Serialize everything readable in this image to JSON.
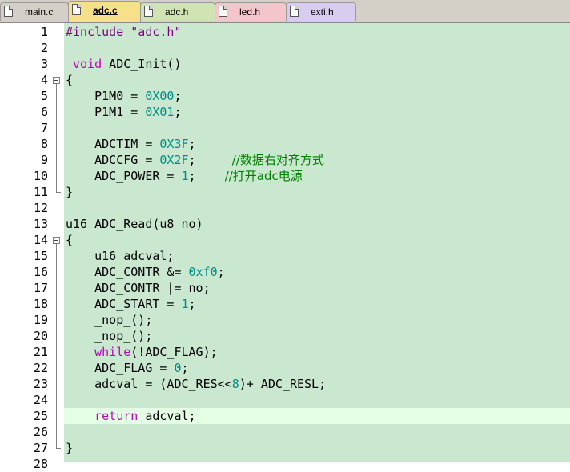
{
  "tabs": [
    {
      "label": "main.c",
      "active": false,
      "color": "#d4d0c8"
    },
    {
      "label": "adc.c",
      "active": true,
      "color": "#f6e18a"
    },
    {
      "label": "adc.h",
      "active": false,
      "color": "#cfe4b2"
    },
    {
      "label": "led.h",
      "active": false,
      "color": "#f4c6cc"
    },
    {
      "label": "exti.h",
      "active": false,
      "color": "#d8cdf0"
    }
  ],
  "editor": {
    "background": "#c9e8cf",
    "current_line_background": "#e5ffe5",
    "current_line": 25,
    "line_numbers": [
      "1",
      "2",
      "3",
      "4",
      "5",
      "6",
      "7",
      "8",
      "9",
      "10",
      "11",
      "12",
      "13",
      "14",
      "15",
      "16",
      "17",
      "18",
      "19",
      "20",
      "21",
      "22",
      "23",
      "24",
      "25",
      "26",
      "27",
      "28"
    ],
    "fold_markers": [
      4,
      14
    ],
    "lines": [
      [
        {
          "t": "#include ",
          "c": "pp"
        },
        {
          "t": "\"adc.h\"",
          "c": "str"
        }
      ],
      [],
      [
        {
          "t": " "
        },
        {
          "t": "void",
          "c": "kw"
        },
        {
          "t": " ADC_Init()"
        }
      ],
      [
        {
          "t": "{"
        }
      ],
      [
        {
          "t": "    P1M0 = "
        },
        {
          "t": "0X00",
          "c": "num"
        },
        {
          "t": ";"
        }
      ],
      [
        {
          "t": "    P1M1 = "
        },
        {
          "t": "0X01",
          "c": "num"
        },
        {
          "t": ";"
        }
      ],
      [],
      [
        {
          "t": "    ADCTIM = "
        },
        {
          "t": "0X3F",
          "c": "num"
        },
        {
          "t": ";"
        }
      ],
      [
        {
          "t": "    ADCCFG = "
        },
        {
          "t": "0X2F",
          "c": "num"
        },
        {
          "t": ";     "
        },
        {
          "t": "//数据右对齐方式",
          "c": "cm"
        }
      ],
      [
        {
          "t": "    ADC_POWER = "
        },
        {
          "t": "1",
          "c": "num"
        },
        {
          "t": ";    "
        },
        {
          "t": "//打开adc电源",
          "c": "cm"
        }
      ],
      [
        {
          "t": "}"
        }
      ],
      [],
      [
        {
          "t": "u16 ADC_Read(u8 no)"
        }
      ],
      [
        {
          "t": "{"
        }
      ],
      [
        {
          "t": "    u16 adcval;"
        }
      ],
      [
        {
          "t": "    ADC_CONTR &= "
        },
        {
          "t": "0xf0",
          "c": "num"
        },
        {
          "t": ";"
        }
      ],
      [
        {
          "t": "    ADC_CONTR |= no;"
        }
      ],
      [
        {
          "t": "    ADC_START = "
        },
        {
          "t": "1",
          "c": "num"
        },
        {
          "t": ";"
        }
      ],
      [
        {
          "t": "    _nop_();"
        }
      ],
      [
        {
          "t": "    _nop_();"
        }
      ],
      [
        {
          "t": "    "
        },
        {
          "t": "while",
          "c": "kw"
        },
        {
          "t": "(!ADC_FLAG);"
        }
      ],
      [
        {
          "t": "    ADC_FLAG = "
        },
        {
          "t": "0",
          "c": "num"
        },
        {
          "t": ";"
        }
      ],
      [
        {
          "t": "    adcval = (ADC_RES<<"
        },
        {
          "t": "8",
          "c": "num"
        },
        {
          "t": ")+ ADC_RESL;"
        }
      ],
      [],
      [
        {
          "t": "    "
        },
        {
          "t": "return",
          "c": "kw"
        },
        {
          "t": " adcval;"
        }
      ],
      [],
      [
        {
          "t": "}"
        }
      ],
      []
    ]
  }
}
